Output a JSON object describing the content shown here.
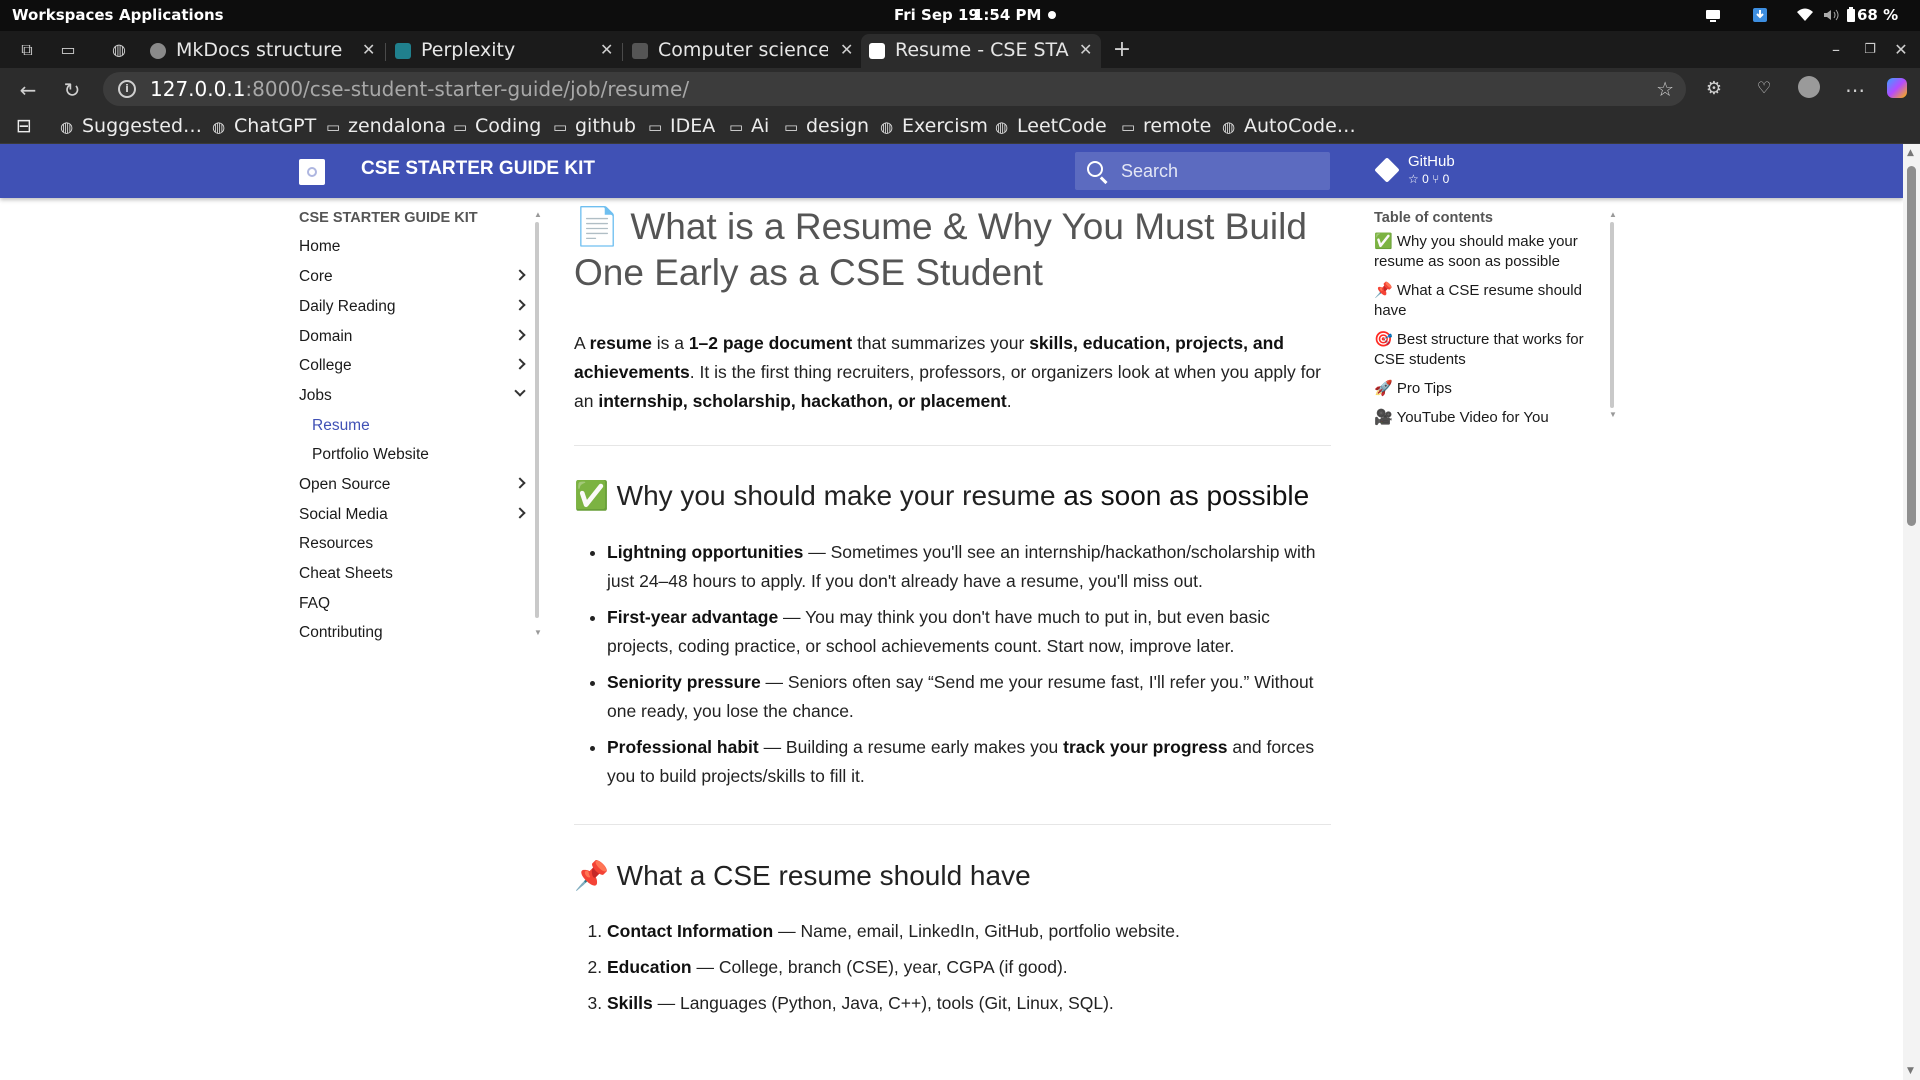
{
  "os": {
    "workspaces": "Workspaces",
    "applications": "Applications",
    "date": "Fri Sep 19",
    "time": "1:54 PM",
    "battery": "68 %"
  },
  "browser": {
    "tabs": [
      {
        "title": "MkDocs structure su",
        "favicon_color": "#8a8a8a",
        "active": false
      },
      {
        "title": "Perplexity",
        "favicon_color": "#20808d",
        "active": false
      },
      {
        "title": "Computer science Ch",
        "favicon_color": "#555555",
        "active": false
      },
      {
        "title": "Resume - CSE START",
        "favicon_color": "#ffffff",
        "active": true
      }
    ],
    "new_tab": "+",
    "url_host": "127.0.0.1",
    "url_path": ":8000/cse-student-starter-guide/job/resume/",
    "bookmarks": [
      {
        "label": "Suggested…",
        "icon": "globe-icon"
      },
      {
        "label": "ChatGPT",
        "icon": "globe-icon"
      },
      {
        "label": "zendalona",
        "icon": "folder-icon"
      },
      {
        "label": "Coding",
        "icon": "folder-icon"
      },
      {
        "label": "github",
        "icon": "folder-icon"
      },
      {
        "label": "IDEA",
        "icon": "folder-icon"
      },
      {
        "label": "Ai",
        "icon": "folder-icon"
      },
      {
        "label": "design",
        "icon": "folder-icon"
      },
      {
        "label": "Exercism",
        "icon": "globe-icon"
      },
      {
        "label": "LeetCode",
        "icon": "globe-icon"
      },
      {
        "label": "remote",
        "icon": "folder-icon"
      },
      {
        "label": "AutoCode…",
        "icon": "globe-icon"
      }
    ]
  },
  "site": {
    "name": "CSE STARTER GUIDE KIT",
    "search_placeholder": "Search",
    "repo_name": "GitHub",
    "repo_stats": "☆ 0  ⑂ 0",
    "header_color": "#4051b5",
    "accent_color": "#4051b5"
  },
  "nav": {
    "title": "CSE STARTER GUIDE KIT",
    "items": [
      {
        "label": "Home",
        "expandable": false
      },
      {
        "label": "Core",
        "expandable": true
      },
      {
        "label": "Daily Reading",
        "expandable": true
      },
      {
        "label": "Domain",
        "expandable": true
      },
      {
        "label": "College",
        "expandable": true
      },
      {
        "label": "Jobs",
        "expandable": true,
        "expanded": true
      },
      {
        "label": "Resume",
        "sub": true,
        "active": true
      },
      {
        "label": "Portfolio Website",
        "sub": true
      },
      {
        "label": "Open Source",
        "expandable": true
      },
      {
        "label": "Social Media",
        "expandable": true
      },
      {
        "label": "Resources",
        "expandable": false
      },
      {
        "label": "Cheat Sheets",
        "expandable": false
      },
      {
        "label": "FAQ",
        "expandable": false
      },
      {
        "label": "Contributing",
        "expandable": false
      }
    ]
  },
  "article": {
    "h1_icon": "📄",
    "h1": "What is a Resume & Why You Must Build One Early as a CSE Student",
    "lead": {
      "a": "A ",
      "b1": "resume",
      "c": " is a ",
      "b2": "1–2 page document",
      "d": " that summarizes your ",
      "b3": "skills, education, projects, and achievements",
      "e": ". It is the first thing recruiters, professors, or organizers look at when you apply for an ",
      "b4": "internship, scholarship, hackathon, or placement",
      "f": "."
    },
    "section1": {
      "icon": "✅",
      "title_plain": "Why you should make your resume ",
      "title_bold": "as soon as possible",
      "items": [
        {
          "bold": "Lightning opportunities",
          "text": " — Sometimes you'll see an internship/hackathon/scholarship with just 24–48 hours to apply. If you don't already have a resume, you'll miss out."
        },
        {
          "bold": "First-year advantage",
          "text": " — You may think you don't have much to put in, but even basic projects, coding practice, or school achievements count. Start now, improve later."
        },
        {
          "bold": "Seniority pressure",
          "text": " — Seniors often say “Send me your resume fast, I'll refer you.” Without one ready, you lose the chance."
        },
        {
          "bold": "Professional habit",
          "text": " — Building a resume early makes you ",
          "bold2": "track your progress",
          "text2": " and forces you to build projects/skills to fill it."
        }
      ]
    },
    "section2": {
      "icon": "📌",
      "title": "What a CSE resume should have",
      "items": [
        {
          "bold": "Contact Information",
          "text": " — Name, email, LinkedIn, GitHub, portfolio website."
        },
        {
          "bold": "Education",
          "text": " — College, branch (CSE), year, CGPA (if good)."
        },
        {
          "bold": "Skills",
          "text": " — Languages (Python, Java, C++), tools (Git, Linux, SQL)."
        }
      ]
    }
  },
  "toc": {
    "title": "Table of contents",
    "items": [
      {
        "label": "✅ Why you should make your resume as soon as possible"
      },
      {
        "label": "📌 What a CSE resume should have"
      },
      {
        "label": "🎯 Best structure that works for CSE students"
      },
      {
        "label": "🚀 Pro Tips"
      },
      {
        "label": "🎥 YouTube Video for You"
      }
    ]
  }
}
